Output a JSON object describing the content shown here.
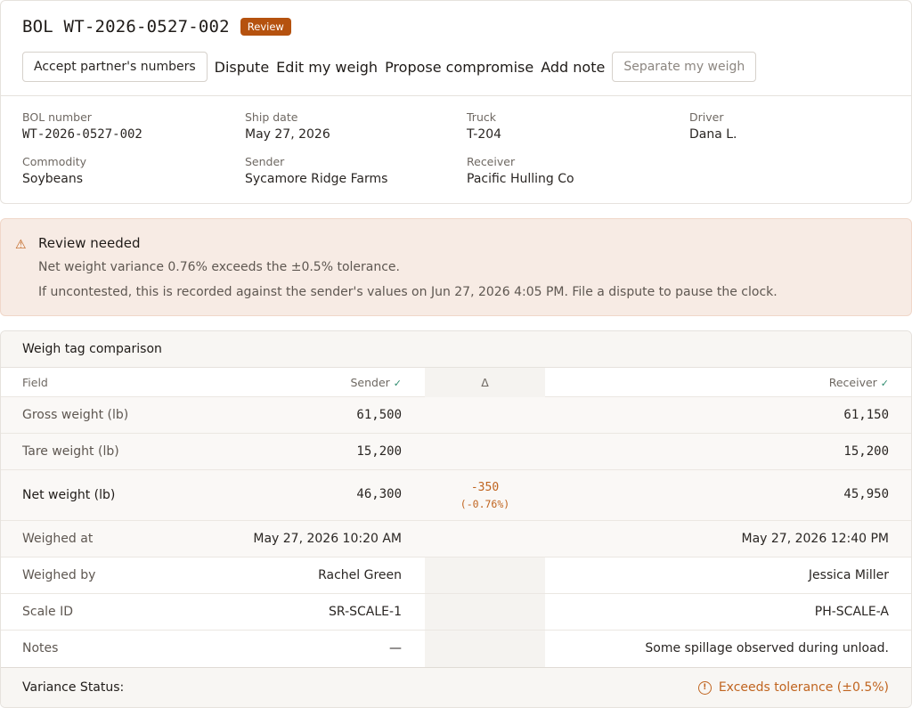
{
  "header": {
    "title": "BOL WT-2026-0527-002",
    "badge": "Review"
  },
  "actions": {
    "accept": "Accept partner's numbers",
    "dispute": "Dispute",
    "edit": "Edit my weigh",
    "propose": "Propose compromise",
    "note": "Add note",
    "separate": "Separate my weigh"
  },
  "meta": {
    "bol_label": "BOL number",
    "bol_value": "WT-2026-0527-002",
    "ship_label": "Ship date",
    "ship_value": "May 27, 2026",
    "truck_label": "Truck",
    "truck_value": "T-204",
    "driver_label": "Driver",
    "driver_value": "Dana L.",
    "commodity_label": "Commodity",
    "commodity_value": "Soybeans",
    "sender_label": "Sender",
    "sender_value": "Sycamore Ridge Farms",
    "receiver_label": "Receiver",
    "receiver_value": "Pacific Hulling Co"
  },
  "alert": {
    "icon": "warning-icon",
    "title": "Review needed",
    "line1": "Net weight variance 0.76% exceeds the ±0.5% tolerance.",
    "line2": "If uncontested, this is recorded against the sender's values on Jun 27, 2026 4:05 PM. File a dispute to pause the clock."
  },
  "comparison": {
    "title": "Weigh tag comparison",
    "headers": {
      "field": "Field",
      "sender": "Sender",
      "delta": "Δ",
      "receiver": "Receiver",
      "check": "✓"
    },
    "rows": [
      {
        "field": "Gross weight (lb)",
        "sender": "61,500",
        "receiver": "61,150",
        "delta": "",
        "delta_pct": ""
      },
      {
        "field": "Tare weight (lb)",
        "sender": "15,200",
        "receiver": "15,200",
        "delta": "",
        "delta_pct": ""
      },
      {
        "field": "Net weight (lb)",
        "sender": "46,300",
        "receiver": "45,950",
        "delta": "-350",
        "delta_pct": "(-0.76%)"
      },
      {
        "field": "Weighed at",
        "sender": "May 27, 2026 10:20 AM",
        "receiver": "May 27, 2026 12:40 PM",
        "delta": "",
        "delta_pct": ""
      },
      {
        "field": "Weighed by",
        "sender": "Rachel Green",
        "receiver": "Jessica Miller",
        "delta": "",
        "delta_pct": ""
      },
      {
        "field": "Scale ID",
        "sender": "SR-SCALE-1",
        "receiver": "PH-SCALE-A",
        "delta": "",
        "delta_pct": ""
      },
      {
        "field": "Notes",
        "sender": "—",
        "receiver": "Some spillage observed during unload.",
        "delta": "",
        "delta_pct": ""
      }
    ],
    "footer": {
      "label": "Variance Status:",
      "status": "Exceeds tolerance (±0.5%)",
      "icon": "alert-circle-icon"
    }
  },
  "colors": {
    "accent": "#b5520f",
    "warning_text": "#c0641f",
    "alert_bg": "#f7ebe4",
    "check": "#2e8b6e"
  }
}
